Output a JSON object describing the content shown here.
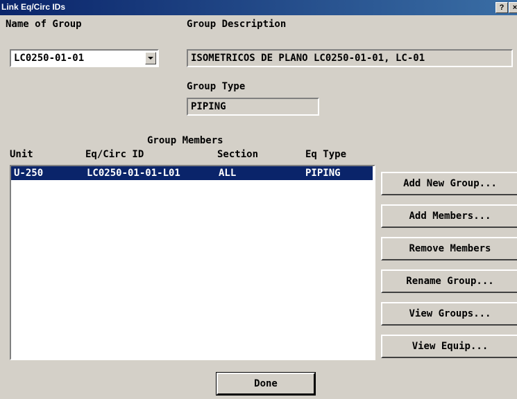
{
  "window": {
    "title": "Link Eq/Circ IDs",
    "help_label": "?",
    "close_label": "×"
  },
  "group_name": {
    "label": "Name of Group",
    "value": "LC0250-01-01"
  },
  "group_description": {
    "label": "Group Description",
    "value": "ISOMETRICOS DE PLANO LC0250-01-01, LC-01"
  },
  "group_type": {
    "label": "Group Type",
    "value": "PIPING"
  },
  "members": {
    "heading": "Group Members",
    "columns": {
      "unit": "Unit",
      "eq_circ_id": "Eq/Circ ID",
      "section": "Section",
      "eq_type": "Eq Type"
    },
    "rows": [
      {
        "unit": "U-250",
        "eq_circ_id": "LC0250-01-01-L01",
        "section": "ALL",
        "eq_type": "PIPING"
      }
    ]
  },
  "buttons": {
    "add_new_group": "Add New Group...",
    "add_members": "Add Members...",
    "remove_members": "Remove Members",
    "rename_group": "Rename Group...",
    "view_groups": "View Groups...",
    "view_equip": "View Equip...",
    "done": "Done"
  }
}
